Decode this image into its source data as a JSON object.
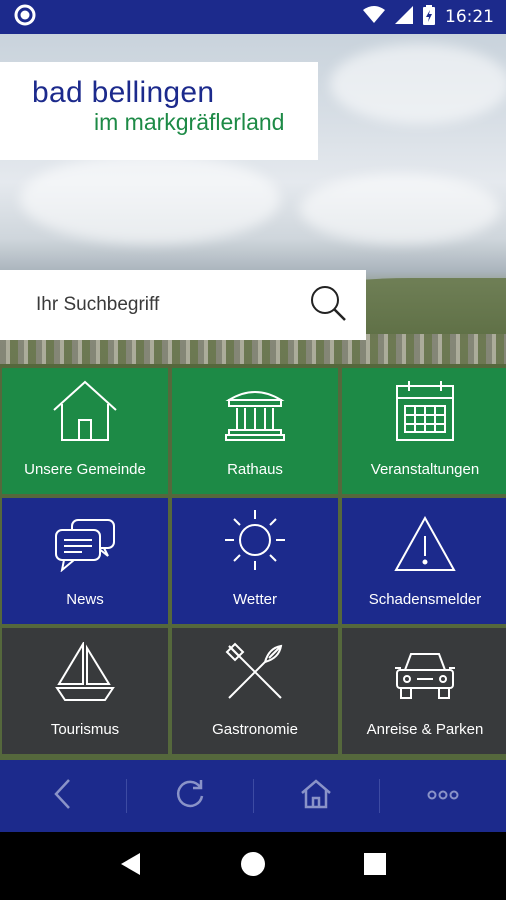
{
  "status_bar": {
    "time": "16:21",
    "icons": [
      "notification-circle-icon",
      "wifi-icon",
      "signal-icon",
      "battery-charging-icon"
    ]
  },
  "header": {
    "logo_title": "bad bellingen",
    "logo_subtitle": "im markgräflerland"
  },
  "search": {
    "placeholder": "Ihr Suchbegriff",
    "icon": "search-icon"
  },
  "tiles": [
    {
      "label": "Unsere Gemeinde",
      "icon": "house-icon",
      "color": "#1d8a46"
    },
    {
      "label": "Rathaus",
      "icon": "town-hall-icon",
      "color": "#1d8a46"
    },
    {
      "label": "Veranstaltungen",
      "icon": "calendar-icon",
      "color": "#1d8a46"
    },
    {
      "label": "News",
      "icon": "chat-bubbles-icon",
      "color": "#1c2a8c"
    },
    {
      "label": "Wetter",
      "icon": "sun-icon",
      "color": "#1c2a8c"
    },
    {
      "label": "Schadensmelder",
      "icon": "warning-icon",
      "color": "#1c2a8c"
    },
    {
      "label": "Tourismus",
      "icon": "sailboat-icon",
      "color": "#383a3c"
    },
    {
      "label": "Gastronomie",
      "icon": "fork-knife-icon",
      "color": "#383a3c"
    },
    {
      "label": "Anreise & Parken",
      "icon": "car-icon",
      "color": "#383a3c"
    }
  ],
  "toolbar": {
    "buttons": [
      "back-icon",
      "reload-icon",
      "home-icon",
      "more-icon"
    ]
  },
  "android_nav": [
    "back-triangle-icon",
    "home-circle-icon",
    "recents-square-icon"
  ],
  "colors": {
    "brand_blue": "#1c2a8c",
    "brand_green": "#1d8a46",
    "tile_dark": "#383a3c"
  }
}
